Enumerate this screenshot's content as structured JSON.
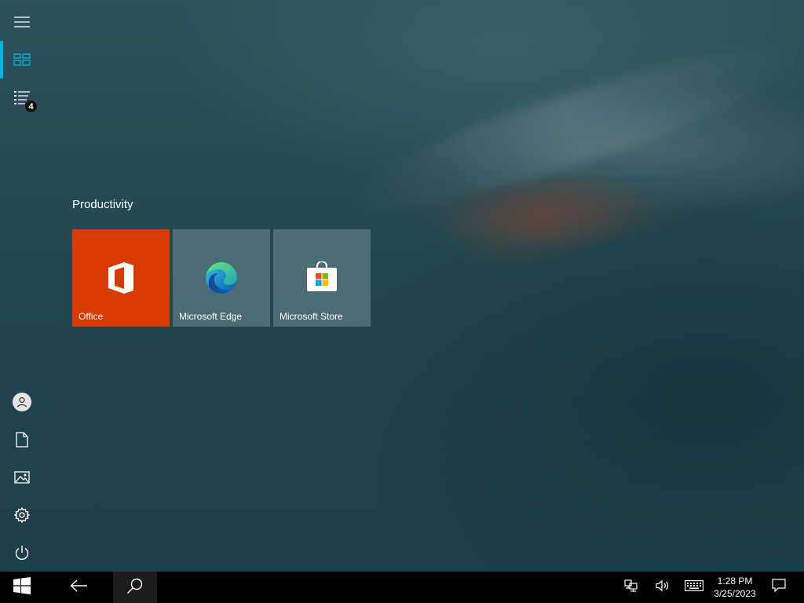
{
  "start_rail": {
    "items": [
      {
        "name": "expand-menu",
        "icon": "hamburger-icon"
      },
      {
        "name": "tiles-view",
        "icon": "tiles-icon",
        "active": true
      },
      {
        "name": "all-apps",
        "icon": "app-list-icon",
        "badge": "4"
      },
      {
        "name": "account",
        "icon": "user-icon"
      },
      {
        "name": "documents",
        "icon": "document-icon"
      },
      {
        "name": "pictures",
        "icon": "pictures-icon"
      },
      {
        "name": "settings",
        "icon": "gear-icon"
      },
      {
        "name": "power",
        "icon": "power-icon"
      }
    ],
    "accent_color": "#00b4d8"
  },
  "tiles": {
    "group_title": "Productivity",
    "items": [
      {
        "label": "Office",
        "icon": "office-icon",
        "color": "#d83b01"
      },
      {
        "label": "Microsoft Edge",
        "icon": "edge-icon",
        "color": "#6e8c92"
      },
      {
        "label": "Microsoft Store",
        "icon": "store-icon",
        "color": "#6e8c92"
      }
    ]
  },
  "taskbar": {
    "start_icon": "windows-logo-icon",
    "back_icon": "back-arrow-icon",
    "search_icon": "search-icon",
    "tray": {
      "network_icon": "network-icon",
      "volume_icon": "volume-icon",
      "keyboard_icon": "keyboard-icon",
      "time": "1:28 PM",
      "date": "3/25/2023",
      "notifications_icon": "notifications-icon"
    }
  }
}
